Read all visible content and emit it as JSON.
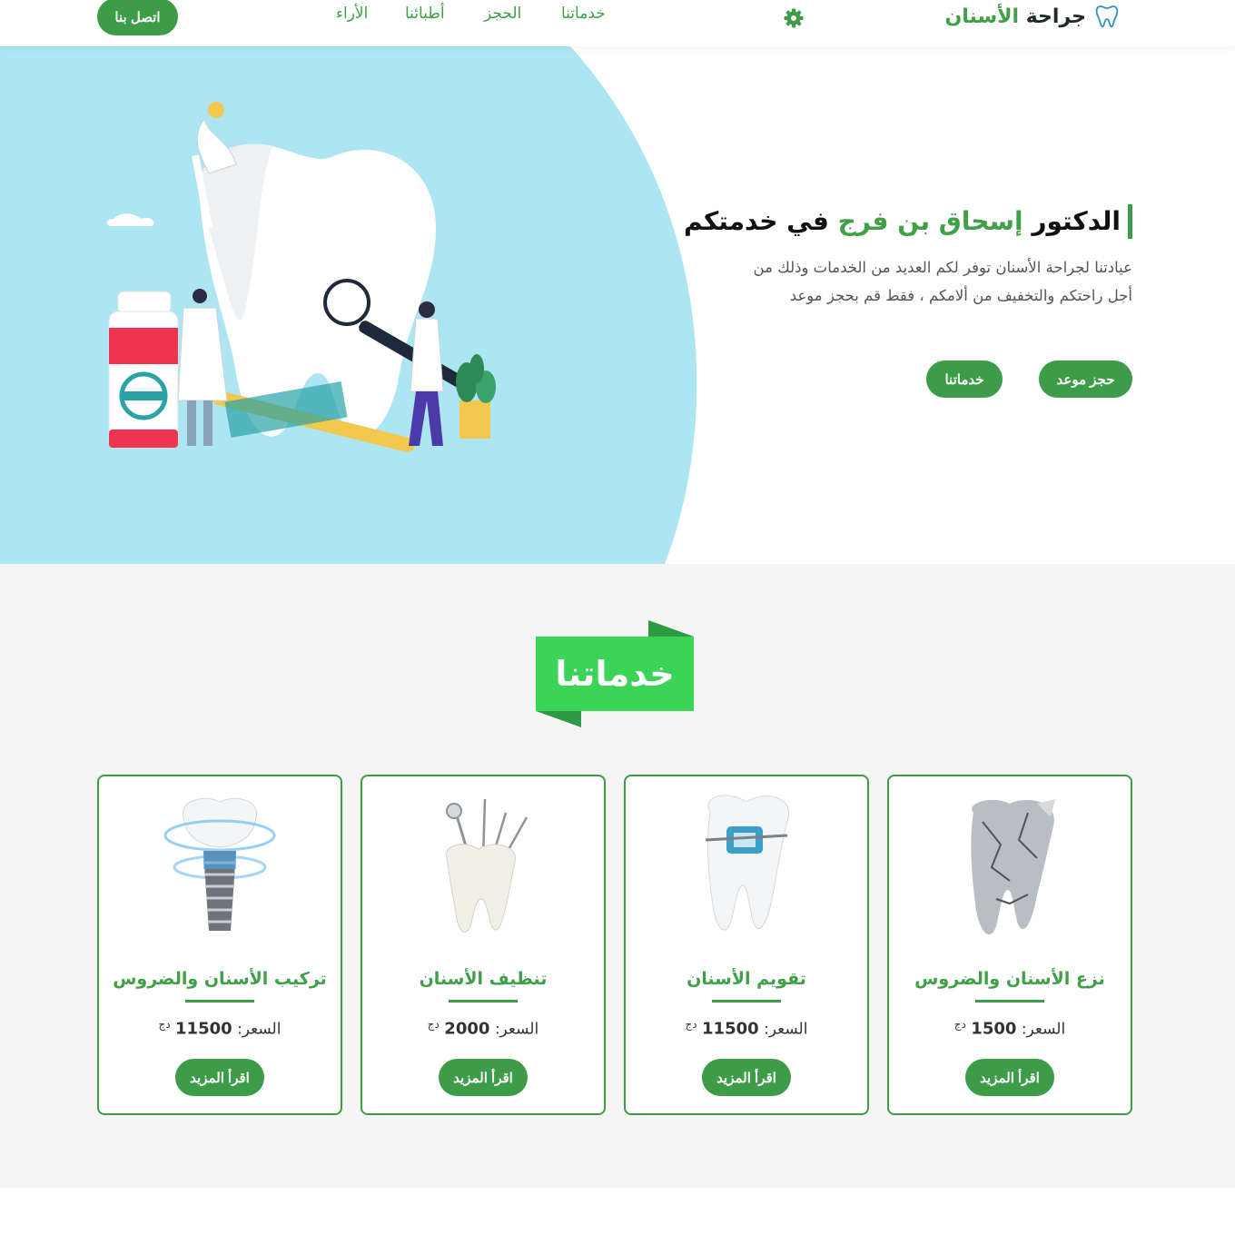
{
  "header": {
    "logo_part1": "جراحة",
    "logo_part2": "الأسنان",
    "nav": [
      "خدماتنا",
      "الحجز",
      "أطبائنا",
      "الأراء"
    ],
    "contact_label": "اتصل بنا"
  },
  "hero": {
    "title_part1": "الدكتور",
    "title_name": "إسحاق بن فرج",
    "title_part2": "في خدمتكم",
    "description": "عيادتنا لجراحة الأسنان توفر لكم العديد من الخدمات وذلك من أجل راحتكم والتخفيف من ألامكم ، فقط قم بحجز موعد",
    "btn_book": "حجز موعد",
    "btn_services": "خدماتنا"
  },
  "services": {
    "heading": "خدماتنا",
    "price_label": "السعر:",
    "currency": "دج",
    "read_more": "اقرأ المزيد",
    "items": [
      {
        "title": "نزع الأسنان والضروس",
        "price": "1500"
      },
      {
        "title": "تقويم الأسنان",
        "price": "11500"
      },
      {
        "title": "تنظيف الأسنان",
        "price": "2000"
      },
      {
        "title": "تركيب الأسنان والضروس",
        "price": "11500"
      }
    ]
  },
  "colors": {
    "accent": "#3d9c47",
    "hero_blob": "#ade5f2",
    "badge": "#3cd456",
    "services_bg": "#f5f5f5"
  }
}
